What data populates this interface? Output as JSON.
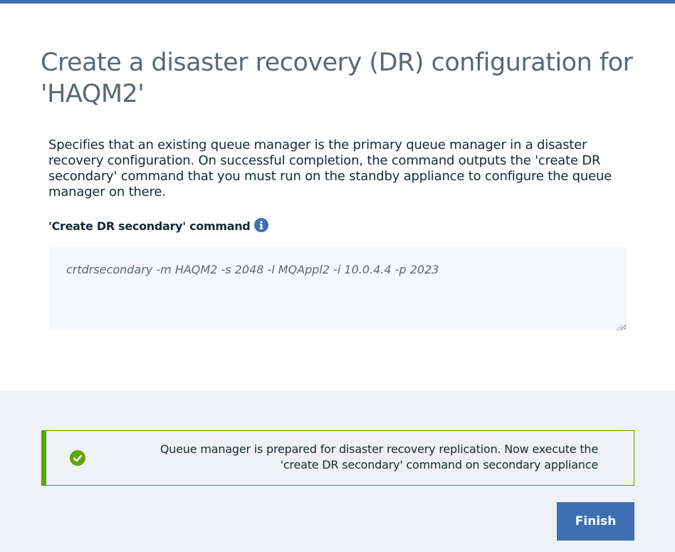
{
  "dialog": {
    "title": "Create a disaster recovery (DR) configuration for 'HAQM2'",
    "description": "Specifies that an existing queue manager is the primary queue manager in a disaster recovery configuration. On successful completion, the command outputs the 'create DR secondary' command that you must run on the standby appliance to configure the queue manager on there.",
    "command_label": "'Create DR secondary' command",
    "command_value": "crtdrsecondary -m HAQM2 -s 2048 -l MQAppl2 -i 10.0.4.4 -p 2023"
  },
  "notification": {
    "status": "success",
    "message_line1": "Queue manager is prepared for disaster recovery replication. Now execute the",
    "message_line2": "'create DR secondary' command on secondary appliance"
  },
  "actions": {
    "finish_label": "Finish"
  },
  "colors": {
    "accent": "#3d70b2",
    "success": "#5aa700",
    "title_text": "#5a6872",
    "body_text": "#152935",
    "footer_bg": "#eef1f5"
  },
  "icons": {
    "info": "info-icon",
    "success": "checkmark-circle-icon",
    "resize": "resize-grip-icon"
  }
}
